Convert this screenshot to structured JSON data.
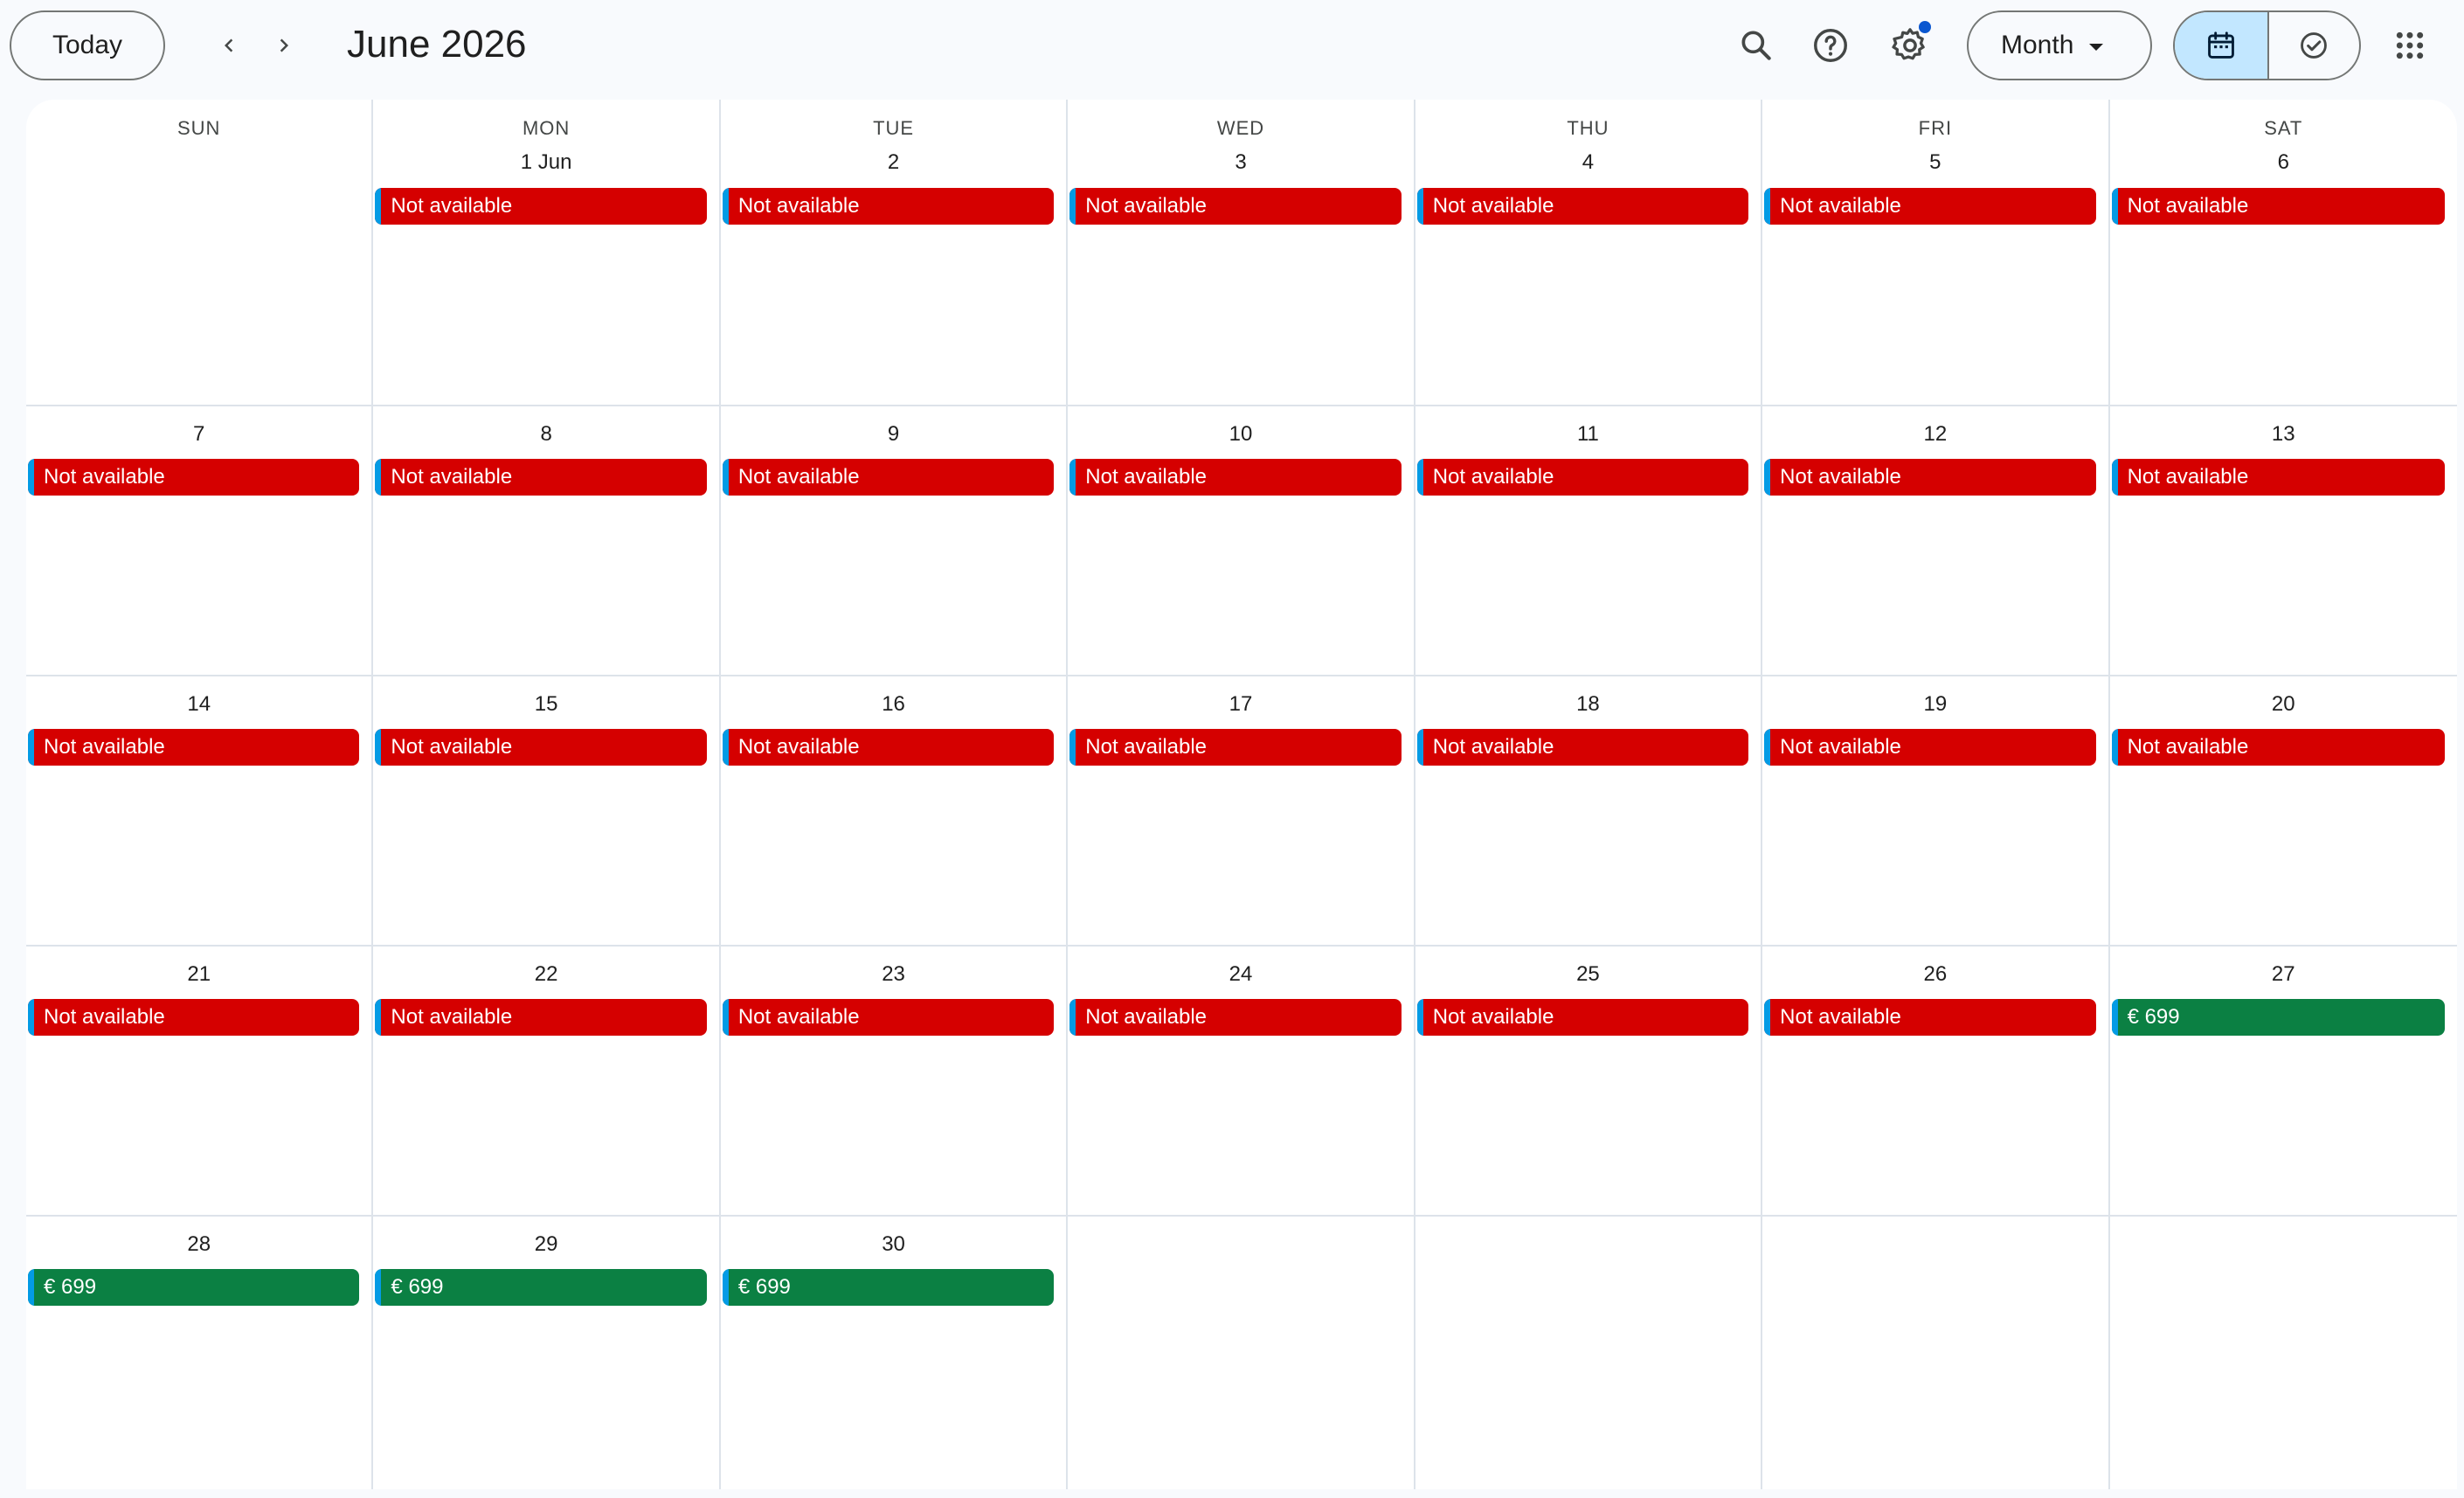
{
  "header": {
    "today_label": "Today",
    "month_title": "June 2026",
    "view_label": "Month",
    "icons": {
      "prev": "chevron-left-icon",
      "next": "chevron-right-icon",
      "search": "search-icon",
      "help": "help-icon",
      "settings": "gear-icon",
      "calendar_view": "calendar-icon",
      "tasks_view": "task-check-icon",
      "apps": "apps-grid-icon"
    }
  },
  "colors": {
    "unavailable": "#d50000",
    "available": "#0b8043",
    "event_stripe": "#039be5",
    "active_toggle": "#c2e7ff",
    "notification_dot": "#0b57d0"
  },
  "weekdays": [
    "SUN",
    "MON",
    "TUE",
    "WED",
    "THU",
    "FRI",
    "SAT"
  ],
  "weeks": [
    [
      {
        "day": "",
        "event": ""
      },
      {
        "day": "1 Jun",
        "event": "Not available",
        "status": "unavailable"
      },
      {
        "day": "2",
        "event": "Not available",
        "status": "unavailable"
      },
      {
        "day": "3",
        "event": "Not available",
        "status": "unavailable"
      },
      {
        "day": "4",
        "event": "Not available",
        "status": "unavailable"
      },
      {
        "day": "5",
        "event": "Not available",
        "status": "unavailable"
      },
      {
        "day": "6",
        "event": "Not available",
        "status": "unavailable"
      }
    ],
    [
      {
        "day": "7",
        "event": "Not available",
        "status": "unavailable"
      },
      {
        "day": "8",
        "event": "Not available",
        "status": "unavailable"
      },
      {
        "day": "9",
        "event": "Not available",
        "status": "unavailable"
      },
      {
        "day": "10",
        "event": "Not available",
        "status": "unavailable"
      },
      {
        "day": "11",
        "event": "Not available",
        "status": "unavailable"
      },
      {
        "day": "12",
        "event": "Not available",
        "status": "unavailable"
      },
      {
        "day": "13",
        "event": "Not available",
        "status": "unavailable"
      }
    ],
    [
      {
        "day": "14",
        "event": "Not available",
        "status": "unavailable"
      },
      {
        "day": "15",
        "event": "Not available",
        "status": "unavailable"
      },
      {
        "day": "16",
        "event": "Not available",
        "status": "unavailable"
      },
      {
        "day": "17",
        "event": "Not available",
        "status": "unavailable"
      },
      {
        "day": "18",
        "event": "Not available",
        "status": "unavailable"
      },
      {
        "day": "19",
        "event": "Not available",
        "status": "unavailable"
      },
      {
        "day": "20",
        "event": "Not available",
        "status": "unavailable"
      }
    ],
    [
      {
        "day": "21",
        "event": "Not available",
        "status": "unavailable"
      },
      {
        "day": "22",
        "event": "Not available",
        "status": "unavailable"
      },
      {
        "day": "23",
        "event": "Not available",
        "status": "unavailable"
      },
      {
        "day": "24",
        "event": "Not available",
        "status": "unavailable"
      },
      {
        "day": "25",
        "event": "Not available",
        "status": "unavailable"
      },
      {
        "day": "26",
        "event": "Not available",
        "status": "unavailable"
      },
      {
        "day": "27",
        "event": "€ 699",
        "status": "available"
      }
    ],
    [
      {
        "day": "28",
        "event": "€ 699",
        "status": "available"
      },
      {
        "day": "29",
        "event": "€ 699",
        "status": "available"
      },
      {
        "day": "30",
        "event": "€ 699",
        "status": "available"
      },
      {
        "day": "",
        "event": ""
      },
      {
        "day": "",
        "event": ""
      },
      {
        "day": "",
        "event": ""
      },
      {
        "day": "",
        "event": ""
      }
    ]
  ]
}
